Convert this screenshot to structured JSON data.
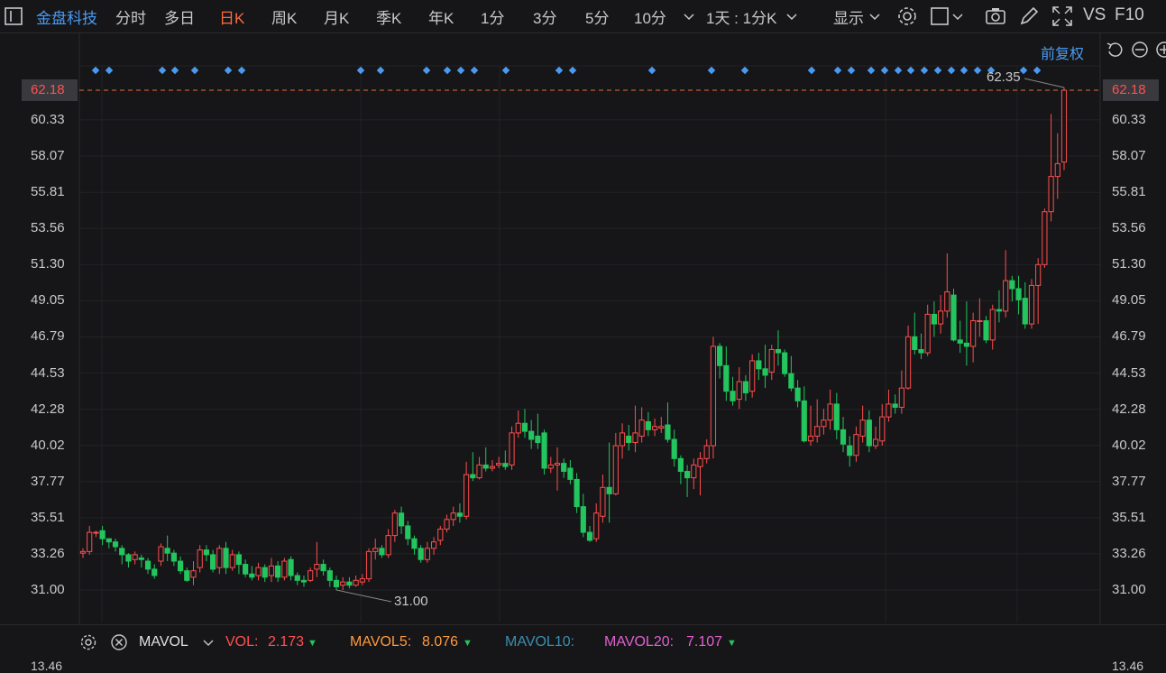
{
  "toolbar": {
    "stock_name": "金盘科技",
    "tabs": [
      {
        "label": "分时"
      },
      {
        "label": "多日"
      },
      {
        "label": "日K"
      },
      {
        "label": "周K"
      },
      {
        "label": "月K"
      },
      {
        "label": "季K"
      },
      {
        "label": "年K"
      },
      {
        "label": "1分"
      },
      {
        "label": "3分"
      },
      {
        "label": "5分"
      },
      {
        "label": "10分"
      }
    ],
    "active_tab": "日K",
    "period_select": "1天 : 1分K",
    "display_label": "显示",
    "vs_label": "VS",
    "f10_label": "F10"
  },
  "sub_bar": {
    "adjust_label": "前复权"
  },
  "price_axis": {
    "ticks": [
      "60.33",
      "58.07",
      "55.81",
      "53.56",
      "51.30",
      "49.05",
      "46.79",
      "44.53",
      "42.28",
      "40.02",
      "37.77",
      "35.51",
      "33.26",
      "31.00"
    ],
    "current_price": "62.18",
    "high_label": "62.35",
    "low_label": "31.00",
    "bottom_tick": "13.46"
  },
  "volume_bar": {
    "indicator": "MAVOL",
    "vol_label": "VOL:",
    "vol_value": "2.173",
    "mavol5_label": "MAVOL5:",
    "mavol5_value": "8.076",
    "mavol10_label": "MAVOL10:",
    "mavol10_value": "",
    "mavol20_label": "MAVOL20:",
    "mavol20_value": "7.107"
  },
  "colors": {
    "up": "#ff4d4d",
    "down": "#22c55e",
    "accent": "#4a9af0",
    "active": "#ff6a3d",
    "mavol5": "#ff9a3c",
    "mavol10": "#3a8fb0",
    "mavol20": "#e060d0"
  },
  "chart_data": {
    "type": "candlestick",
    "ylim": [
      31.0,
      62.35
    ],
    "candles": [
      [
        33.3,
        33.4,
        33.0,
        33.6
      ],
      [
        33.4,
        34.6,
        33.2,
        35.0
      ],
      [
        34.6,
        34.6,
        34.3,
        34.7
      ],
      [
        34.7,
        34.2,
        33.8,
        35.0
      ],
      [
        34.2,
        34.0,
        33.6,
        34.2
      ],
      [
        34.0,
        33.7,
        33.4,
        34.2
      ],
      [
        33.6,
        33.2,
        32.6,
        33.8
      ],
      [
        33.2,
        32.8,
        32.4,
        33.3
      ],
      [
        32.9,
        33.2,
        32.6,
        33.4
      ],
      [
        33.0,
        32.9,
        32.4,
        33.2
      ],
      [
        32.8,
        32.3,
        32.0,
        33.0
      ],
      [
        32.3,
        31.9,
        31.7,
        32.6
      ],
      [
        32.8,
        33.7,
        32.5,
        33.9
      ],
      [
        33.6,
        33.3,
        32.8,
        34.4
      ],
      [
        33.3,
        32.8,
        32.5,
        33.5
      ],
      [
        32.8,
        32.2,
        32.0,
        33.1
      ],
      [
        32.2,
        31.6,
        31.5,
        32.4
      ],
      [
        31.8,
        32.2,
        31.3,
        32.8
      ],
      [
        32.4,
        33.5,
        32.1,
        33.8
      ],
      [
        33.5,
        33.2,
        32.8,
        33.8
      ],
      [
        33.2,
        32.3,
        32.1,
        33.5
      ],
      [
        32.4,
        33.6,
        32.0,
        33.8
      ],
      [
        33.6,
        32.4,
        32.0,
        34.0
      ],
      [
        32.4,
        33.2,
        32.2,
        33.5
      ],
      [
        33.2,
        32.6,
        32.0,
        33.4
      ],
      [
        32.6,
        32.0,
        31.8,
        32.9
      ],
      [
        32.0,
        31.8,
        31.6,
        32.5
      ],
      [
        31.9,
        32.4,
        31.6,
        32.7
      ],
      [
        32.4,
        31.8,
        31.5,
        32.6
      ],
      [
        31.9,
        32.5,
        31.5,
        33.0
      ],
      [
        32.5,
        31.8,
        31.5,
        32.8
      ],
      [
        31.8,
        32.8,
        31.6,
        33.0
      ],
      [
        32.9,
        31.9,
        31.6,
        33.1
      ],
      [
        31.9,
        31.6,
        31.3,
        32.1
      ],
      [
        31.6,
        31.5,
        31.2,
        31.9
      ],
      [
        31.6,
        32.2,
        31.5,
        32.4
      ],
      [
        32.3,
        32.6,
        31.8,
        34.0
      ],
      [
        32.6,
        32.2,
        31.9,
        32.9
      ],
      [
        32.2,
        31.6,
        31.2,
        32.4
      ],
      [
        31.6,
        31.2,
        31.0,
        31.9
      ],
      [
        31.3,
        31.5,
        31.0,
        31.8
      ],
      [
        31.5,
        31.3,
        31.1,
        31.8
      ],
      [
        31.3,
        31.6,
        31.2,
        31.9
      ],
      [
        31.5,
        31.7,
        31.3,
        32.0
      ],
      [
        31.7,
        33.4,
        31.5,
        33.6
      ],
      [
        33.4,
        33.6,
        32.9,
        34.2
      ],
      [
        33.6,
        33.2,
        33.0,
        33.8
      ],
      [
        33.2,
        34.4,
        33.0,
        34.8
      ],
      [
        34.4,
        35.8,
        34.0,
        36.0
      ],
      [
        35.8,
        35.0,
        34.5,
        36.2
      ],
      [
        35.0,
        34.2,
        33.8,
        35.3
      ],
      [
        34.2,
        33.6,
        33.2,
        34.4
      ],
      [
        33.6,
        32.9,
        32.7,
        33.8
      ],
      [
        32.9,
        33.6,
        32.7,
        34.0
      ],
      [
        33.6,
        34.0,
        33.2,
        34.3
      ],
      [
        34.1,
        34.8,
        33.8,
        35.0
      ],
      [
        34.8,
        35.4,
        34.6,
        35.7
      ],
      [
        35.4,
        35.8,
        35.0,
        36.2
      ],
      [
        35.8,
        35.6,
        35.2,
        36.4
      ],
      [
        35.6,
        38.2,
        35.4,
        39.0
      ],
      [
        38.2,
        38.0,
        37.8,
        39.6
      ],
      [
        38.0,
        38.8,
        37.9,
        39.3
      ],
      [
        38.8,
        38.6,
        38.4,
        39.9
      ],
      [
        38.6,
        38.7,
        38.4,
        39.1
      ],
      [
        38.8,
        38.9,
        38.6,
        39.3
      ],
      [
        38.9,
        38.7,
        38.5,
        39.7
      ],
      [
        38.8,
        40.8,
        38.5,
        41.2
      ],
      [
        40.8,
        41.4,
        40.5,
        42.2
      ],
      [
        41.4,
        40.9,
        40.5,
        42.3
      ],
      [
        40.9,
        40.4,
        39.8,
        41.6
      ],
      [
        40.6,
        40.2,
        39.8,
        42.0
      ],
      [
        40.8,
        38.6,
        38.2,
        41.0
      ],
      [
        38.6,
        38.8,
        38.3,
        39.3
      ],
      [
        38.8,
        38.9,
        37.2,
        39.9
      ],
      [
        38.9,
        38.4,
        38.0,
        39.2
      ],
      [
        38.6,
        37.9,
        37.6,
        39.1
      ],
      [
        37.9,
        36.2,
        35.8,
        38.3
      ],
      [
        36.2,
        34.6,
        34.3,
        37.0
      ],
      [
        34.6,
        34.1,
        34.0,
        35.0
      ],
      [
        34.2,
        35.8,
        34.0,
        36.4
      ],
      [
        35.6,
        37.4,
        35.2,
        38.2
      ],
      [
        37.4,
        37.0,
        35.2,
        40.2
      ],
      [
        37.0,
        40.0,
        36.9,
        40.8
      ],
      [
        40.0,
        40.8,
        39.2,
        41.4
      ],
      [
        40.6,
        40.2,
        39.7,
        41.3
      ],
      [
        40.2,
        40.8,
        39.6,
        42.5
      ],
      [
        40.6,
        41.6,
        40.2,
        42.4
      ],
      [
        41.5,
        41.0,
        40.6,
        42.1
      ],
      [
        41.0,
        41.2,
        40.6,
        41.7
      ],
      [
        41.1,
        41.2,
        40.8,
        41.8
      ],
      [
        41.3,
        40.4,
        40.2,
        42.7
      ],
      [
        40.4,
        39.2,
        38.7,
        41.0
      ],
      [
        39.2,
        38.4,
        37.6,
        39.4
      ],
      [
        38.4,
        38.0,
        36.8,
        38.8
      ],
      [
        38.0,
        38.8,
        37.3,
        39.2
      ],
      [
        38.7,
        39.2,
        36.9,
        39.6
      ],
      [
        39.2,
        40.0,
        38.9,
        40.4
      ],
      [
        40.0,
        46.2,
        39.2,
        46.8
      ],
      [
        46.2,
        45.0,
        44.2,
        46.4
      ],
      [
        45.0,
        43.4,
        42.8,
        46.2
      ],
      [
        43.4,
        42.8,
        42.5,
        44.3
      ],
      [
        42.9,
        44.0,
        42.3,
        44.9
      ],
      [
        44.0,
        43.3,
        42.8,
        44.4
      ],
      [
        43.4,
        45.3,
        43.0,
        45.7
      ],
      [
        45.3,
        44.8,
        44.1,
        45.8
      ],
      [
        44.8,
        44.4,
        43.6,
        46.3
      ],
      [
        44.6,
        46.0,
        44.1,
        46.3
      ],
      [
        46.0,
        45.8,
        45.0,
        47.2
      ],
      [
        45.8,
        44.5,
        44.3,
        46.0
      ],
      [
        44.5,
        43.6,
        43.4,
        45.6
      ],
      [
        43.6,
        42.8,
        42.4,
        44.1
      ],
      [
        42.8,
        40.3,
        40.2,
        43.7
      ],
      [
        40.3,
        40.6,
        40.0,
        42.5
      ],
      [
        40.6,
        41.2,
        40.2,
        42.9
      ],
      [
        41.2,
        41.6,
        40.7,
        42.3
      ],
      [
        41.6,
        42.6,
        41.0,
        43.5
      ],
      [
        42.6,
        41.0,
        40.4,
        43.3
      ],
      [
        41.0,
        40.1,
        39.6,
        41.8
      ],
      [
        40.0,
        39.4,
        38.7,
        40.6
      ],
      [
        39.4,
        40.7,
        39.0,
        41.2
      ],
      [
        40.6,
        41.6,
        40.2,
        42.5
      ],
      [
        41.6,
        40.0,
        39.6,
        42.2
      ],
      [
        40.0,
        40.4,
        39.8,
        41.2
      ],
      [
        40.3,
        41.8,
        40.0,
        42.6
      ],
      [
        41.8,
        42.6,
        41.5,
        43.5
      ],
      [
        42.6,
        42.4,
        42.0,
        43.2
      ],
      [
        42.4,
        43.6,
        42.0,
        44.7
      ],
      [
        43.6,
        46.8,
        43.5,
        47.5
      ],
      [
        46.8,
        46.0,
        45.7,
        48.3
      ],
      [
        46.0,
        45.8,
        45.4,
        47.0
      ],
      [
        45.8,
        48.2,
        45.6,
        48.8
      ],
      [
        48.2,
        47.6,
        46.8,
        49.0
      ],
      [
        47.6,
        48.4,
        47.0,
        49.4
      ],
      [
        48.4,
        49.6,
        48.0,
        52.0
      ],
      [
        49.4,
        46.6,
        46.5,
        49.8
      ],
      [
        46.6,
        46.4,
        45.8,
        47.8
      ],
      [
        46.4,
        46.2,
        45.0,
        49.0
      ],
      [
        46.2,
        47.8,
        45.2,
        48.3
      ],
      [
        47.8,
        47.8,
        46.8,
        49.2
      ],
      [
        47.8,
        46.6,
        46.4,
        48.1
      ],
      [
        46.6,
        48.5,
        46.0,
        48.8
      ],
      [
        48.5,
        48.4,
        47.7,
        49.7
      ],
      [
        48.4,
        50.3,
        48.0,
        52.2
      ],
      [
        50.3,
        49.8,
        49.0,
        50.6
      ],
      [
        49.8,
        49.1,
        48.2,
        50.6
      ],
      [
        49.2,
        47.6,
        47.3,
        50.2
      ],
      [
        47.6,
        50.0,
        47.3,
        50.4
      ],
      [
        50.0,
        51.3,
        47.6,
        51.7
      ],
      [
        51.3,
        54.6,
        51.1,
        54.8
      ],
      [
        54.6,
        56.8,
        54.0,
        60.7
      ],
      [
        56.8,
        57.6,
        55.4,
        59.5
      ],
      [
        57.7,
        62.18,
        57.2,
        62.35
      ]
    ]
  }
}
